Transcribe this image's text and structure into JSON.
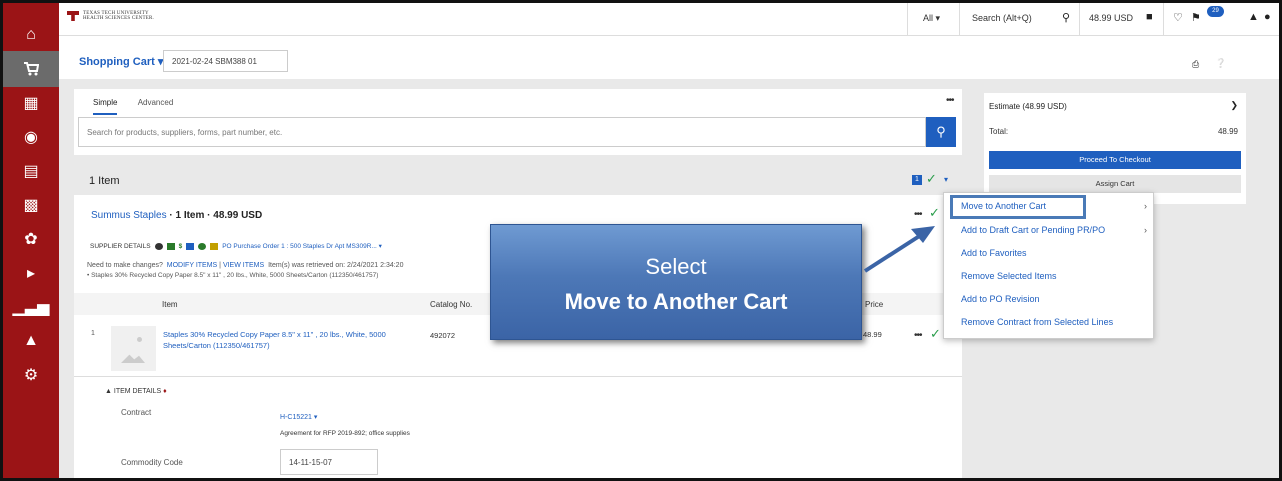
{
  "topbar": {
    "logo_text_line1": "TEXAS TECH UNIVERSITY",
    "logo_text_line2": "HEALTH SCIENCES CENTER.",
    "scope": "All",
    "search_placeholder": "Search (Alt+Q)",
    "cart_total": "48.99 USD",
    "notification_count": "29"
  },
  "header": {
    "cart_label": "Shopping Cart",
    "cart_name": "2021-02-24 SBM388 01"
  },
  "search_panel": {
    "tabs": [
      "Simple",
      "Advanced"
    ],
    "placeholder": "Search for products, suppliers, forms, part number, etc."
  },
  "cart": {
    "item_count": "1 Item",
    "selected_count": "1"
  },
  "supplier": {
    "name": "Summus Staples",
    "summary": " · 1 Item · 48.99 USD",
    "details_label": "SUPPLIER DETAILS",
    "po_text": "PO Purchase Order 1 : 500 Staples Dr Apt MS309R...",
    "need_changes": "Need to make changes?",
    "modify_items": "MODIFY ITEMS",
    "view_items": "VIEW ITEMS",
    "retrieved": "Item(s) was retrieved on: 2/24/2021 2:34:20",
    "bullet_item": "Staples 30% Recycled Copy Paper 8.5\" x 11\" , 20 lbs., White, 5000 Sheets/Carton (112350/461757)"
  },
  "table": {
    "headers": {
      "item": "Item",
      "catalog": "Catalog No.",
      "price": "Price"
    },
    "rows": [
      {
        "num": "1",
        "product": "Staples 30% Recycled Copy Paper 8.5\" x 11\" , 20 lbs., White, 5000 Sheets/Carton (112350/461757)",
        "catalog_no": "492072",
        "price": "48.99"
      }
    ]
  },
  "item_details": {
    "heading": "ITEM DETAILS",
    "contract_label": "Contract",
    "contract_value": "H-C15221",
    "contract_desc": "Agreement for RFP 2019-892; office supplies",
    "commodity_label": "Commodity Code",
    "commodity_value": "14-11-15-07"
  },
  "estimate": {
    "title": "Estimate (48.99 USD)",
    "total_label": "Total:",
    "total_value": "48.99",
    "proceed_label": "Proceed To Checkout",
    "assign_label": "Assign Cart"
  },
  "context_menu": {
    "items": [
      "Move to Another Cart",
      "Add to Draft Cart or Pending PR/PO",
      "Add to Favorites",
      "Remove Selected Items",
      "Add to PO Revision",
      "Remove Contract from Selected Lines"
    ]
  },
  "callout": {
    "line1": "Select",
    "line2": "Move to Another Cart"
  },
  "colors": {
    "brand_red": "#9b1416",
    "accent_blue": "#1f5fbf",
    "callout_blue": "#4d78b7",
    "success_green": "#2a9d4b"
  }
}
